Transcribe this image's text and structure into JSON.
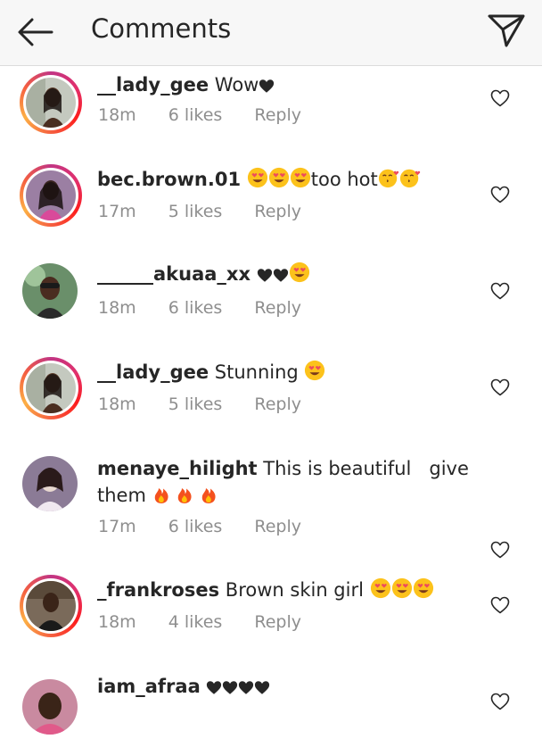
{
  "header": {
    "title": "Comments",
    "back_icon": "arrow-left-icon",
    "share_icon": "paper-plane-icon"
  },
  "colors": {
    "text": "#262626",
    "meta": "#8e8e8e",
    "header_bg": "#f7f7f7"
  },
  "comments": [
    {
      "username": "__lady_gee",
      "text": "Wow",
      "emojis": [
        "black-heart"
      ],
      "time": "18m",
      "likes": "6 likes",
      "reply": "Reply",
      "story_ring": true
    },
    {
      "username": "bec.brown.01",
      "text": "too hot",
      "emojis_before": [
        "heart-eyes",
        "heart-eyes",
        "heart-eyes"
      ],
      "emojis": [
        "kissing-heart",
        "kissing-heart"
      ],
      "time": "17m",
      "likes": "5 likes",
      "reply": "Reply",
      "story_ring": true
    },
    {
      "username": "______akuaa_xx",
      "text": "",
      "emojis": [
        "black-heart",
        "black-heart",
        "heart-eyes"
      ],
      "time": "18m",
      "likes": "6 likes",
      "reply": "Reply",
      "story_ring": false
    },
    {
      "username": "__lady_gee",
      "text": "Stunning",
      "emojis": [
        "heart-eyes"
      ],
      "time": "18m",
      "likes": "5 likes",
      "reply": "Reply",
      "story_ring": true
    },
    {
      "username": "menaye_hilight",
      "text": "This is beautiful   give them",
      "emojis": [
        "fire",
        "fire",
        "fire"
      ],
      "time": "17m",
      "likes": "6 likes",
      "reply": "Reply",
      "story_ring": false
    },
    {
      "username": "_frankroses",
      "text": "Brown skin girl",
      "emojis": [
        "heart-eyes",
        "heart-eyes",
        "heart-eyes"
      ],
      "time": "18m",
      "likes": "4 likes",
      "reply": "Reply",
      "story_ring": true
    },
    {
      "username": "iam_afraa",
      "text": "",
      "emojis": [
        "black-heart",
        "black-heart",
        "black-heart",
        "black-heart"
      ],
      "time": "",
      "likes": "",
      "reply": "",
      "story_ring": false
    }
  ]
}
